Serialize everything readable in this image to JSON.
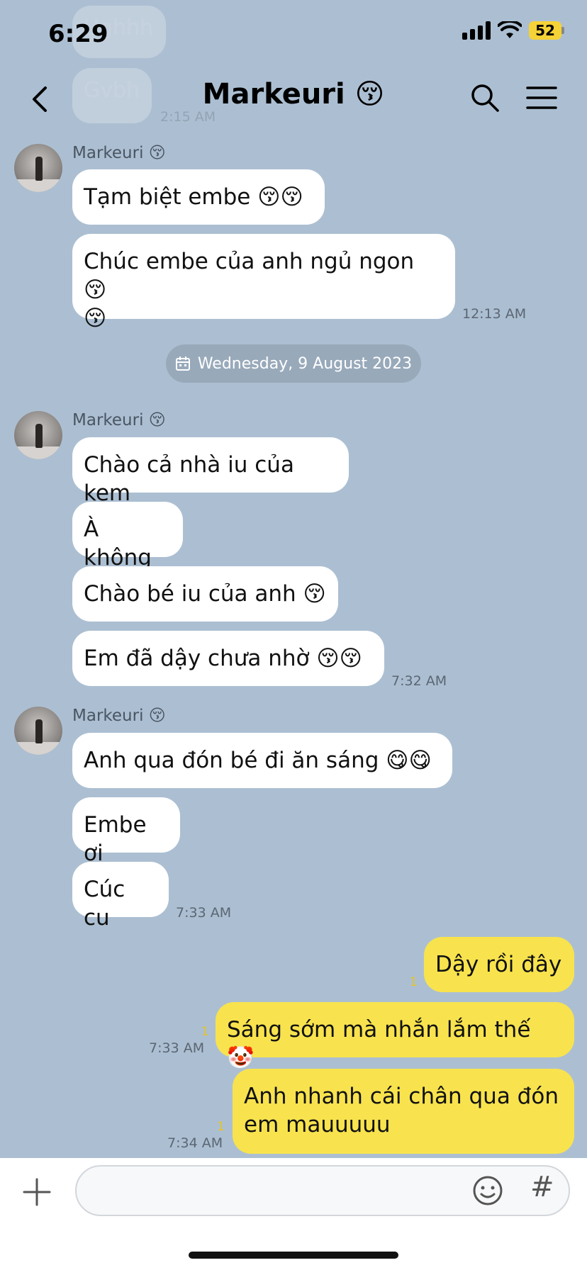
{
  "status_bar": {
    "time": "6:29",
    "battery": "52"
  },
  "header": {
    "title": "Markeuri 😚"
  },
  "ghost_messages": [
    "Ughhh",
    "Gvbh"
  ],
  "ghost_timestamp": "2:15 AM",
  "groups": [
    {
      "sender": "Markeuri 😚",
      "messages": [
        "Tạm biệt embe 😚😚",
        "Chúc embe của anh ngủ ngon 😚\n😚"
      ],
      "timestamp": "12:13 AM"
    },
    {
      "sender": "Markeuri 😚",
      "messages": [
        "Chào cả nhà iu của kem",
        "À không",
        "Chào bé iu của anh 😚",
        "Em đã dậy chưa nhờ 😚😚"
      ],
      "timestamp": "7:32 AM"
    },
    {
      "sender": "Markeuri 😚",
      "messages": [
        "Anh qua đón bé đi ăn sáng 😋😋",
        "Embe ơi",
        "Cúc cu"
      ],
      "timestamp": "7:33 AM"
    }
  ],
  "date_separator": "Wednesday, 9 August 2023",
  "my_messages": [
    {
      "text": "Dậy rồi đây",
      "read": "1",
      "timestamp": ""
    },
    {
      "text": "Sáng sớm mà nhắn lắm thế 🤡",
      "read": "1",
      "timestamp": "7:33 AM"
    },
    {
      "text": "Anh nhanh cái chân qua đón\nem mauuuuu",
      "read": "1",
      "timestamp": "7:34 AM"
    }
  ],
  "composer": {
    "placeholder": "",
    "hash_label": "#"
  },
  "colors": {
    "background": "#acbfd2",
    "my_bubble": "#f8e34e",
    "their_bubble": "#ffffff"
  }
}
